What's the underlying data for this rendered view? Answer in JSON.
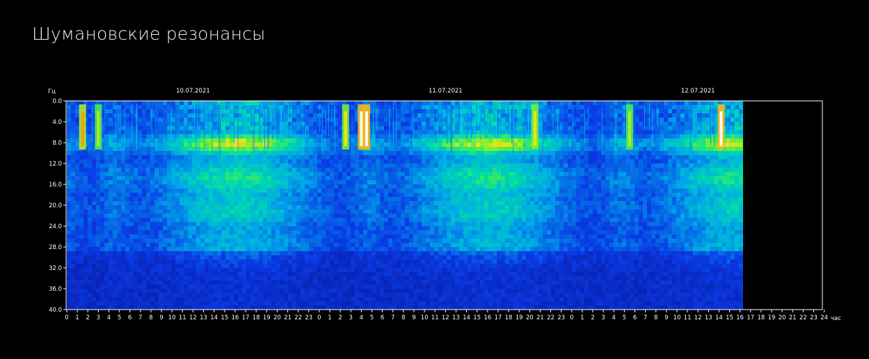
{
  "page": {
    "title": "Шумановские резонансы"
  },
  "chart_data": {
    "type": "heatmap",
    "title": "",
    "ylabel": "Гц",
    "xlabel": "час",
    "ylim": [
      0,
      40
    ],
    "y_ticks": [
      "0.0",
      "4.0",
      "8.0",
      "12.0",
      "16.0",
      "20.0",
      "24.0",
      "28.0",
      "32.0",
      "36.0",
      "40.0"
    ],
    "x_range_hours": [
      0,
      72
    ],
    "data_end_hour": 64.5,
    "days": [
      {
        "date": "10.07.2021",
        "start_hour": 0
      },
      {
        "date": "11.07.2021",
        "start_hour": 24
      },
      {
        "date": "12.07.2021",
        "start_hour": 48
      }
    ],
    "hour_ticks_day1": [
      "0",
      "1",
      "2",
      "3",
      "4",
      "5",
      "6",
      "7",
      "8",
      "9",
      "10",
      "11",
      "12",
      "13",
      "14",
      "15",
      "16",
      "17",
      "18",
      "19",
      "20",
      "21",
      "22",
      "23"
    ],
    "hour_ticks_day2": [
      "0",
      "1",
      "2",
      "3",
      "4",
      "5",
      "6",
      "7",
      "8",
      "9",
      "10",
      "11",
      "12",
      "13",
      "14",
      "15",
      "16",
      "17",
      "18",
      "19",
      "20",
      "21",
      "22",
      "23"
    ],
    "hour_ticks_day3": [
      "0",
      "1",
      "2",
      "3",
      "4",
      "5",
      "6",
      "7",
      "8",
      "9",
      "10",
      "11",
      "12",
      "13",
      "14",
      "15",
      "16",
      "17",
      "18",
      "19",
      "20",
      "21",
      "22",
      "23",
      "24"
    ],
    "resonance_bands_hz": [
      7.8,
      14.3,
      20.8,
      27.3
    ],
    "colors": {
      "background": "#000000",
      "frame": "#ffffff",
      "low": "#0a1a9e",
      "mid": "#00c8d8",
      "high": "#ffe000",
      "peak": "#ffffff"
    }
  }
}
